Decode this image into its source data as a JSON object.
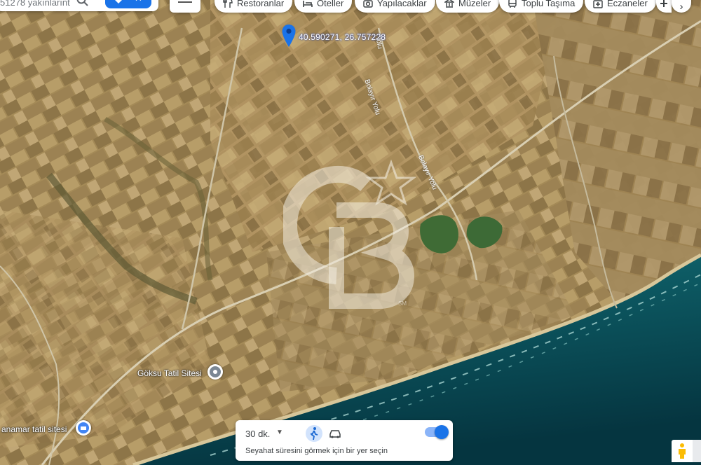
{
  "search": {
    "text": "51278 yakınlarınt"
  },
  "chips": [
    {
      "label": "Restoranlar",
      "icon": "fork-knife-icon"
    },
    {
      "label": "Oteller",
      "icon": "bed-icon"
    },
    {
      "label": "Yapılacaklar",
      "icon": "camera-icon"
    },
    {
      "label": "Müzeler",
      "icon": "museum-icon"
    },
    {
      "label": "Toplu Taşıma",
      "icon": "bus-icon"
    },
    {
      "label": "Eczaneler",
      "icon": "pharmacy-icon"
    }
  ],
  "map": {
    "pin_coordinates": "40.590271, 26.757228",
    "road_labels": [
      "Bolayır Yolu",
      "Bolayır Yolu",
      "Yolu"
    ],
    "places": [
      "Göksu Tatil Sitesi",
      "anamar tatil sitesi"
    ],
    "watermark": {
      "brand": "CB",
      "mark": "SM"
    },
    "colors": {
      "sea": "#0d5a63",
      "sea_deep": "#063d47",
      "land": "#a88f5e",
      "pin": "#1a73e8"
    }
  },
  "travel": {
    "time": "30 dk.",
    "hint": "Seyahat süresini görmek için bir yer seçin",
    "modes": [
      "walk-icon",
      "car-icon"
    ]
  }
}
